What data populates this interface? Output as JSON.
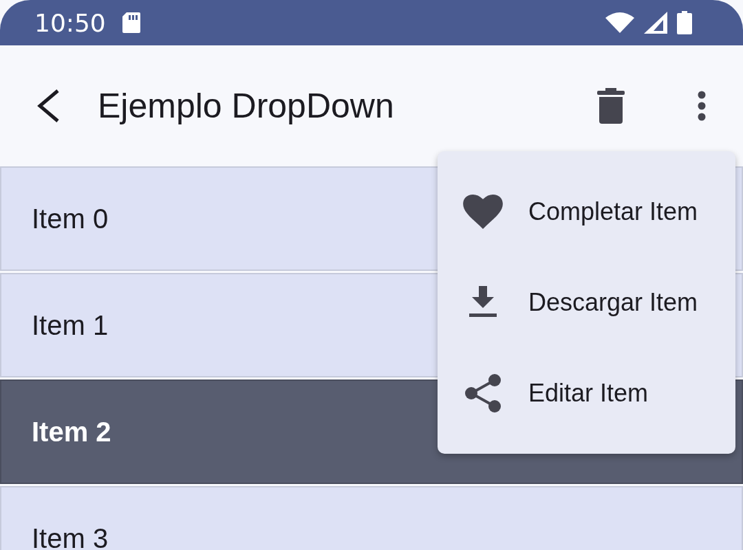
{
  "status_bar": {
    "time": "10:50"
  },
  "app_bar": {
    "title": "Ejemplo DropDown"
  },
  "list": [
    {
      "label": "Item 0",
      "selected": false
    },
    {
      "label": "Item 1",
      "selected": false
    },
    {
      "label": "Item 2",
      "selected": true
    },
    {
      "label": "Item 3",
      "selected": false
    }
  ],
  "menu": {
    "items": [
      {
        "label": "Completar Item"
      },
      {
        "label": "Descargar Item"
      },
      {
        "label": "Editar Item"
      }
    ]
  }
}
